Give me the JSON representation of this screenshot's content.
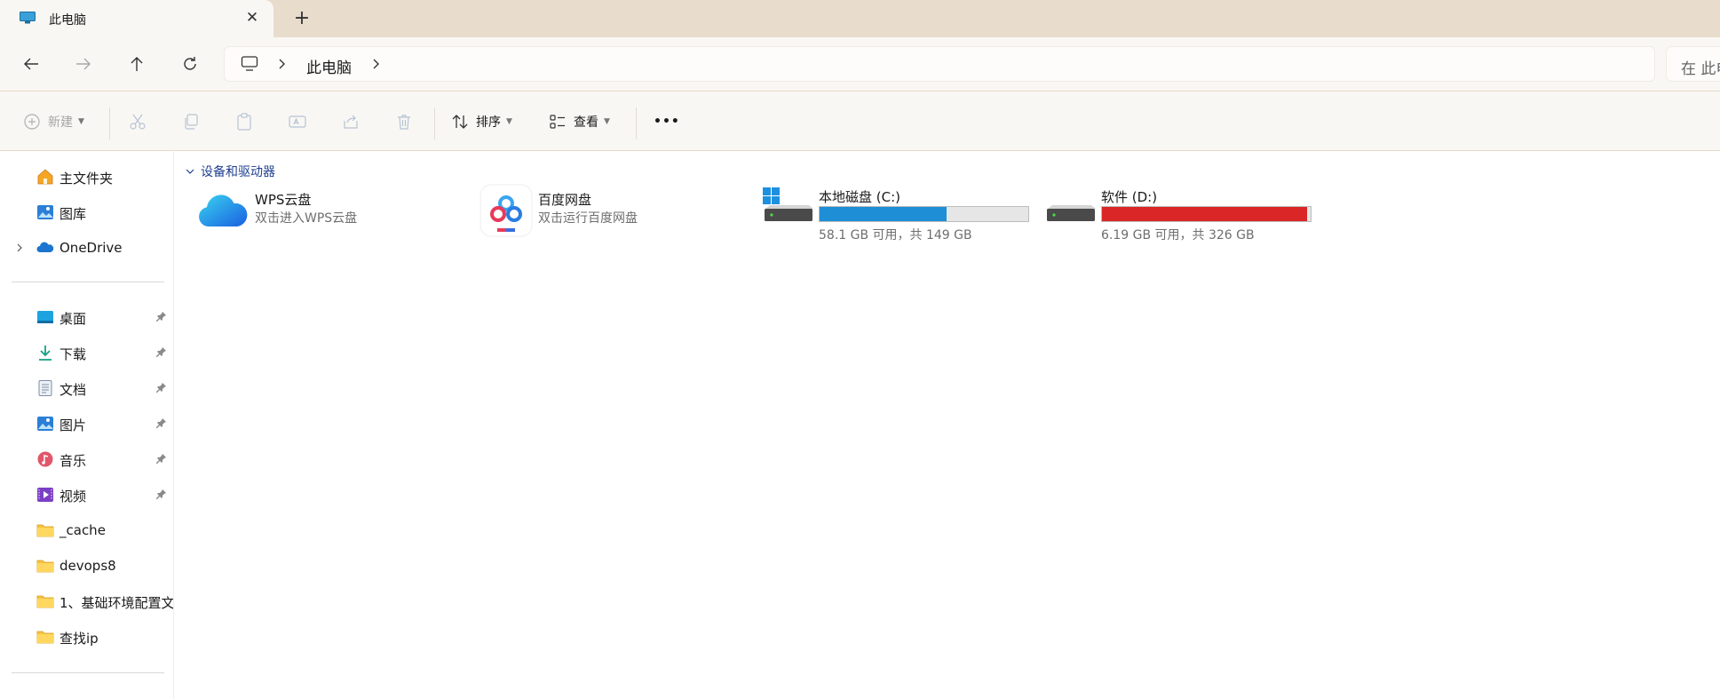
{
  "window": {
    "tab_title": "此电脑",
    "close_glyph": "✕",
    "new_tab_glyph": "+"
  },
  "nav": {
    "breadcrumb": [
      "此电脑"
    ],
    "search_placeholder": "在 此电脑 中搜索"
  },
  "toolbar": {
    "new_label": "新建",
    "sort_label": "排序",
    "view_label": "查看",
    "more_label": "•••"
  },
  "sidebar": {
    "top_items": [
      {
        "label": "主文件夹",
        "icon": "home-icon"
      },
      {
        "label": "图库",
        "icon": "gallery-icon"
      },
      {
        "label": "OneDrive",
        "icon": "onedrive-cloud-icon"
      }
    ],
    "quick_access": [
      {
        "label": "桌面",
        "icon": "desktop-icon",
        "pinned": true
      },
      {
        "label": "下载",
        "icon": "download-icon",
        "pinned": true
      },
      {
        "label": "文档",
        "icon": "document-icon",
        "pinned": true
      },
      {
        "label": "图片",
        "icon": "pictures-icon",
        "pinned": true
      },
      {
        "label": "音乐",
        "icon": "music-icon",
        "pinned": true
      },
      {
        "label": "视频",
        "icon": "video-icon",
        "pinned": true
      },
      {
        "label": "_cache",
        "icon": "folder-icon",
        "pinned": false
      },
      {
        "label": "devops8",
        "icon": "folder-icon",
        "pinned": false
      },
      {
        "label": "1、基础环境配置文",
        "icon": "folder-icon",
        "pinned": false
      },
      {
        "label": "查找ip",
        "icon": "folder-icon",
        "pinned": false
      }
    ]
  },
  "content": {
    "group_title": "设备和驱动器",
    "items": [
      {
        "name": "WPS云盘",
        "subtitle": "双击进入WPS云盘",
        "icon": "wps-cloud-icon"
      },
      {
        "name": "百度网盘",
        "subtitle": "双击运行百度网盘",
        "icon": "baidu-netdisk-icon"
      },
      {
        "name": "本地磁盘 (C:)",
        "subtitle": "58.1 GB 可用，共 149 GB",
        "icon": "windows-drive-icon",
        "used_fraction": 0.61,
        "bar_color": "#1e8fd6"
      },
      {
        "name": "软件 (D:)",
        "subtitle": "6.19 GB 可用，共 326 GB",
        "icon": "drive-icon",
        "used_fraction": 0.981,
        "bar_color": "#da2626"
      }
    ]
  },
  "colors": {
    "tab_strip": "#e8dccd",
    "accent_blue": "#1e8fd6",
    "warning_red": "#da2626",
    "group_header": "#1f3f8f"
  }
}
